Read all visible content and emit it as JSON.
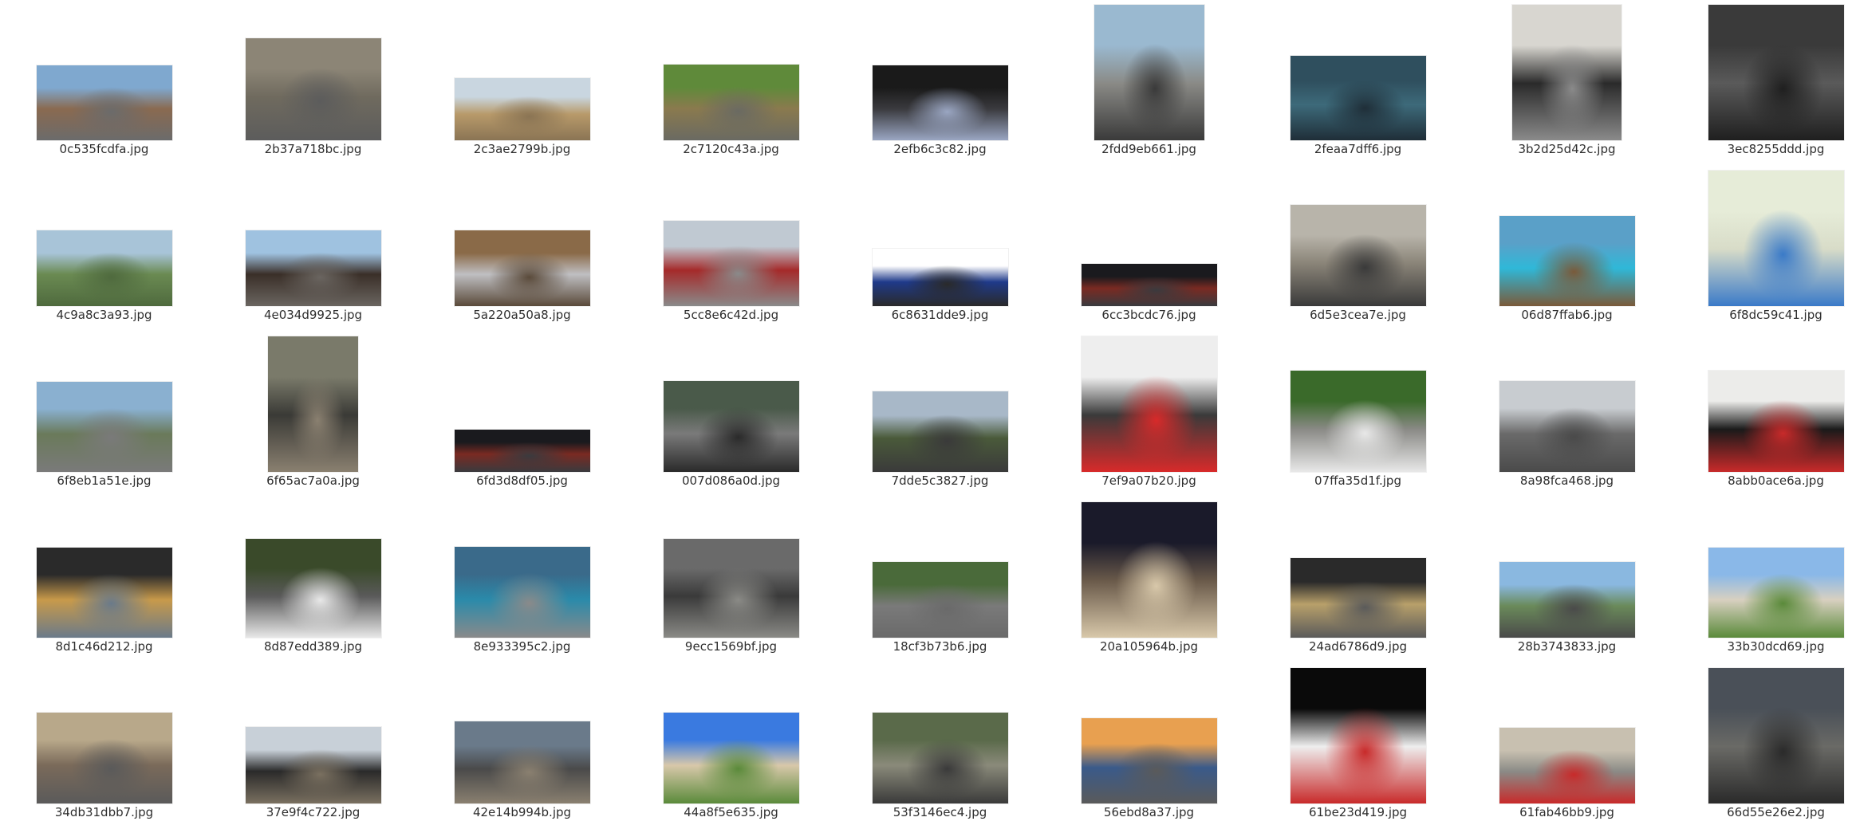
{
  "file_browser": {
    "view": "icon-grid",
    "files": [
      {
        "name": "0c535fcdfa.jpg",
        "icon": "photo-thumbnail",
        "colors": [
          "#7fa8cf",
          "#8a6a50",
          "#6b6b6b"
        ]
      },
      {
        "name": "2b37a718bc.jpg",
        "icon": "photo-thumbnail",
        "colors": [
          "#8c8576",
          "#6f6a5e",
          "#5c5c5c"
        ]
      },
      {
        "name": "2c3ae2799b.jpg",
        "icon": "photo-thumbnail",
        "colors": [
          "#c9d6e0",
          "#b89a6a",
          "#8a7454"
        ]
      },
      {
        "name": "2c7120c43a.jpg",
        "icon": "photo-thumbnail",
        "colors": [
          "#5f8a3a",
          "#8a7a4e",
          "#6a6a62"
        ]
      },
      {
        "name": "2efb6c3c82.jpg",
        "icon": "photo-thumbnail",
        "colors": [
          "#1a1a1a",
          "#3a3a3e",
          "#9aa6c2"
        ]
      },
      {
        "name": "2fdd9eb661.jpg",
        "icon": "photo-thumbnail",
        "colors": [
          "#9ab9d0",
          "#8a8a86",
          "#3a3a3a"
        ]
      },
      {
        "name": "2feaa7dff6.jpg",
        "icon": "photo-thumbnail",
        "colors": [
          "#2f4f5e",
          "#3d6a7a",
          "#1f2e38"
        ]
      },
      {
        "name": "3b2d25d42c.jpg",
        "icon": "photo-thumbnail",
        "colors": [
          "#d8d6d0",
          "#2a2a2a",
          "#8a8a8a"
        ]
      },
      {
        "name": "3ec8255ddd.jpg",
        "icon": "photo-thumbnail",
        "colors": [
          "#3a3a3a",
          "#5a5a5a",
          "#1f1f1f"
        ]
      },
      {
        "name": "4c9a8c3a93.jpg",
        "icon": "photo-thumbnail",
        "colors": [
          "#a8c4d8",
          "#6a8a52",
          "#4f6a3e"
        ]
      },
      {
        "name": "4e034d9925.jpg",
        "icon": "photo-thumbnail",
        "colors": [
          "#9fc2e0",
          "#3a2f28",
          "#6a6560"
        ]
      },
      {
        "name": "5a220a50a8.jpg",
        "icon": "photo-thumbnail",
        "colors": [
          "#8a6a48",
          "#bfbfc2",
          "#5a4a3a"
        ]
      },
      {
        "name": "5cc8e6c42d.jpg",
        "icon": "photo-thumbnail",
        "colors": [
          "#c0c9d2",
          "#a52a2a",
          "#8a8a8a"
        ]
      },
      {
        "name": "6c8631dde9.jpg",
        "icon": "photo-thumbnail",
        "colors": [
          "#ffffff",
          "#1f3a8a",
          "#2a2a2a"
        ]
      },
      {
        "name": "6cc3bcdc76.jpg",
        "icon": "photo-thumbnail",
        "colors": [
          "#1a1a1e",
          "#7a2a22",
          "#3a3a3e"
        ]
      },
      {
        "name": "6d5e3cea7e.jpg",
        "icon": "photo-thumbnail",
        "colors": [
          "#b8b4aa",
          "#8a8478",
          "#3a3a3a"
        ]
      },
      {
        "name": "06d87ffab6.jpg",
        "icon": "photo-thumbnail",
        "colors": [
          "#5aa0c8",
          "#2fb8d8",
          "#7a5a3a"
        ]
      },
      {
        "name": "6f8dc59c41.jpg",
        "icon": "photo-thumbnail",
        "colors": [
          "#e6ecd8",
          "#d8dcc8",
          "#3a7ac8"
        ]
      },
      {
        "name": "6f8eb1a51e.jpg",
        "icon": "photo-thumbnail",
        "colors": [
          "#8ab0d0",
          "#6a7a5a",
          "#7a7a7a"
        ]
      },
      {
        "name": "6f65ac7a0a.jpg",
        "icon": "photo-thumbnail",
        "colors": [
          "#7a7a6a",
          "#3a3a36",
          "#8a8070"
        ]
      },
      {
        "name": "6fd3d8df05.jpg",
        "icon": "photo-thumbnail",
        "colors": [
          "#1a1a1e",
          "#7a2a22",
          "#3a3a3e"
        ]
      },
      {
        "name": "007d086a0d.jpg",
        "icon": "photo-thumbnail",
        "colors": [
          "#4a5a4a",
          "#7a7a7a",
          "#2a2a2a"
        ]
      },
      {
        "name": "7dde5c3827.jpg",
        "icon": "photo-thumbnail",
        "colors": [
          "#a8b8c8",
          "#4a5a3a",
          "#3a3a3a"
        ]
      },
      {
        "name": "7ef9a07b20.jpg",
        "icon": "photo-thumbnail",
        "colors": [
          "#eeeeee",
          "#3a3a3a",
          "#d82a2a"
        ]
      },
      {
        "name": "07ffa35d1f.jpg",
        "icon": "photo-thumbnail",
        "colors": [
          "#3a6a2a",
          "#8a8a86",
          "#e8e8e8"
        ]
      },
      {
        "name": "8a98fca468.jpg",
        "icon": "photo-thumbnail",
        "colors": [
          "#c8ccd0",
          "#6a6a6a",
          "#4a4a4a"
        ]
      },
      {
        "name": "8abb0ace6a.jpg",
        "icon": "photo-thumbnail",
        "colors": [
          "#ececea",
          "#1a1a1a",
          "#c82a2a"
        ]
      },
      {
        "name": "8d1c46d212.jpg",
        "icon": "photo-thumbnail",
        "colors": [
          "#2a2a2a",
          "#c89a4a",
          "#6a7a8a"
        ]
      },
      {
        "name": "8d87edd389.jpg",
        "icon": "photo-thumbnail",
        "colors": [
          "#3a4a2a",
          "#5a5a5a",
          "#e8e8e8"
        ]
      },
      {
        "name": "8e933395c2.jpg",
        "icon": "photo-thumbnail",
        "colors": [
          "#3a6a8a",
          "#2a8aaa",
          "#8a8a8a"
        ]
      },
      {
        "name": "9ecc1569bf.jpg",
        "icon": "photo-thumbnail",
        "colors": [
          "#6a6a6a",
          "#3a3a3a",
          "#8a8a86"
        ]
      },
      {
        "name": "18cf3b73b6.jpg",
        "icon": "photo-thumbnail",
        "colors": [
          "#4a6a3a",
          "#7a7a7a",
          "#6a6a6a"
        ]
      },
      {
        "name": "20a105964b.jpg",
        "icon": "photo-thumbnail",
        "colors": [
          "#1a1a2a",
          "#6a5a4a",
          "#d8c8aa"
        ]
      },
      {
        "name": "24ad6786d9.jpg",
        "icon": "photo-thumbnail",
        "colors": [
          "#2a2a2a",
          "#b8a06a",
          "#5a5a5a"
        ]
      },
      {
        "name": "28b3743833.jpg",
        "icon": "photo-thumbnail",
        "colors": [
          "#8ab8e0",
          "#6a8a5a",
          "#4a4a4a"
        ]
      },
      {
        "name": "33b30dcd69.jpg",
        "icon": "photo-thumbnail",
        "colors": [
          "#8ab8e8",
          "#d8d0c0",
          "#5a8a3a"
        ]
      },
      {
        "name": "34db31dbb7.jpg",
        "icon": "photo-thumbnail",
        "colors": [
          "#b8a88a",
          "#7a6a5a",
          "#5a5a5a"
        ]
      },
      {
        "name": "37e9f4c722.jpg",
        "icon": "photo-thumbnail",
        "colors": [
          "#c8d0d8",
          "#2a2a2a",
          "#7a7060"
        ]
      },
      {
        "name": "42e14b994b.jpg",
        "icon": "photo-thumbnail",
        "colors": [
          "#6a7a8a",
          "#4a4a4a",
          "#8a8070"
        ]
      },
      {
        "name": "44a8f5e635.jpg",
        "icon": "photo-thumbnail",
        "colors": [
          "#3a7ae0",
          "#d8c8aa",
          "#5a8a3a"
        ]
      },
      {
        "name": "53f3146ec4.jpg",
        "icon": "photo-thumbnail",
        "colors": [
          "#5a6a4a",
          "#8a8a7a",
          "#3a3a3a"
        ]
      },
      {
        "name": "56ebd8a37.jpg",
        "icon": "photo-thumbnail",
        "colors": [
          "#e8a050",
          "#3a5a8a",
          "#5a5a5a"
        ]
      },
      {
        "name": "61be23d419.jpg",
        "icon": "photo-thumbnail",
        "colors": [
          "#0a0a0a",
          "#eeeeee",
          "#c82a2a"
        ]
      },
      {
        "name": "61fab46bb9.jpg",
        "icon": "photo-thumbnail",
        "colors": [
          "#c8c0b0",
          "#8a8a86",
          "#c82a2a"
        ]
      },
      {
        "name": "66d55e26e2.jpg",
        "icon": "photo-thumbnail",
        "colors": [
          "#4a5058",
          "#6a6a66",
          "#2a2a2a"
        ]
      }
    ]
  }
}
